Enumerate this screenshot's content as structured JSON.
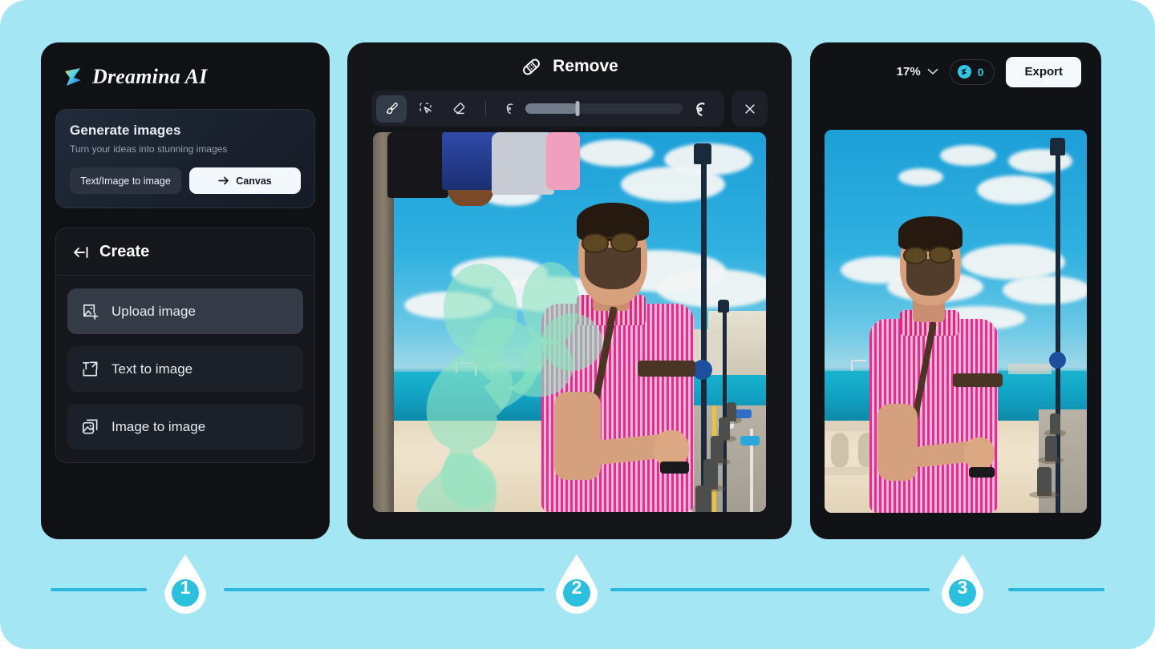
{
  "theme": {
    "page_background": "#A5E6F4",
    "panel_background": "#131418",
    "accent_cyan": "#2CB8DA",
    "credit_cyan": "#2EC8E6",
    "mask_green": "#8FE3C2"
  },
  "left_panel": {
    "brand": {
      "icon": "dreamina-logo-icon",
      "name": "Dreamina AI"
    },
    "generate_card": {
      "title": "Generate images",
      "subtitle": "Turn your ideas into stunning images",
      "buttons": [
        {
          "label": "Text/Image to image",
          "style": "dark",
          "icon": null
        },
        {
          "label": "Canvas",
          "style": "light",
          "icon": "arrow-right-icon"
        }
      ]
    },
    "create_panel": {
      "back_icon": "collapse-left-icon",
      "title": "Create",
      "items": [
        {
          "label": "Upload image",
          "icon": "upload-image-icon",
          "active": true
        },
        {
          "label": "Text to image",
          "icon": "text-to-image-icon",
          "active": false
        },
        {
          "label": "Image to image",
          "icon": "image-to-image-icon",
          "active": false
        }
      ]
    }
  },
  "middle_panel": {
    "header": {
      "icon": "bandage-icon",
      "title": "Remove"
    },
    "toolbar": {
      "tools": [
        {
          "name": "brush-tool",
          "icon": "brush-icon",
          "selected": true
        },
        {
          "name": "select-tool",
          "icon": "lasso-select-icon",
          "selected": false
        },
        {
          "name": "eraser-tool",
          "icon": "eraser-icon",
          "selected": false
        }
      ],
      "brush_size": {
        "small_icon": "small-stroke-icon",
        "large_icon": "large-stroke-icon",
        "value_percent": 33
      },
      "close_icon": "close-icon"
    },
    "canvas": {
      "alt": "Photo of man in pink striped shirt with sunglasses on seaside promenade; background people highlighted with green removal mask"
    }
  },
  "right_panel": {
    "header": {
      "zoom_level": "17%",
      "zoom_chevron_icon": "chevron-down-icon",
      "credits": {
        "icon": "credit-coin-icon",
        "count": "0"
      },
      "export_label": "Export"
    },
    "canvas": {
      "alt": "Result photo of man in pink striped shirt alone on seaside promenade after background people removed"
    }
  },
  "steps": [
    {
      "number": "1"
    },
    {
      "number": "2"
    },
    {
      "number": "3"
    }
  ]
}
